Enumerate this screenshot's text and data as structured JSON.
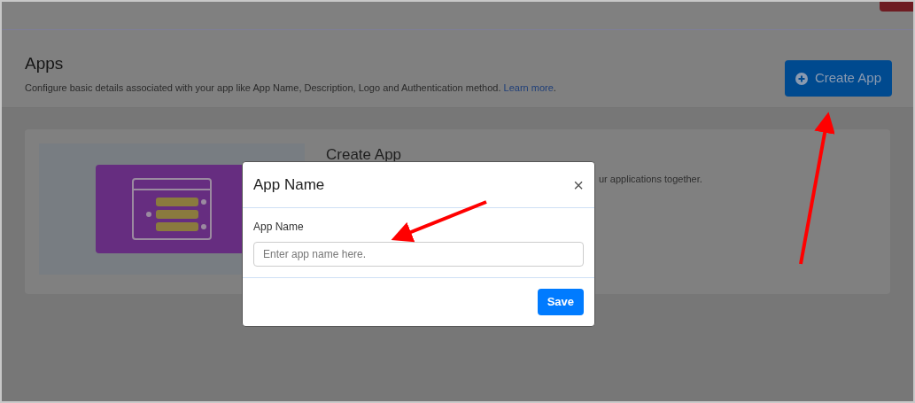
{
  "page": {
    "title": "Apps",
    "description": "Configure basic details associated with your app like App Name, Description, Logo and Authentication method.",
    "learn_more": "Learn more",
    "learn_more_suffix": ".",
    "create_button": "Create App"
  },
  "card": {
    "title": "Create App",
    "description": "ur applications together."
  },
  "modal": {
    "title": "App Name",
    "close": "×",
    "field_label": "App Name",
    "field_placeholder": "Enter app name here.",
    "save": "Save"
  }
}
